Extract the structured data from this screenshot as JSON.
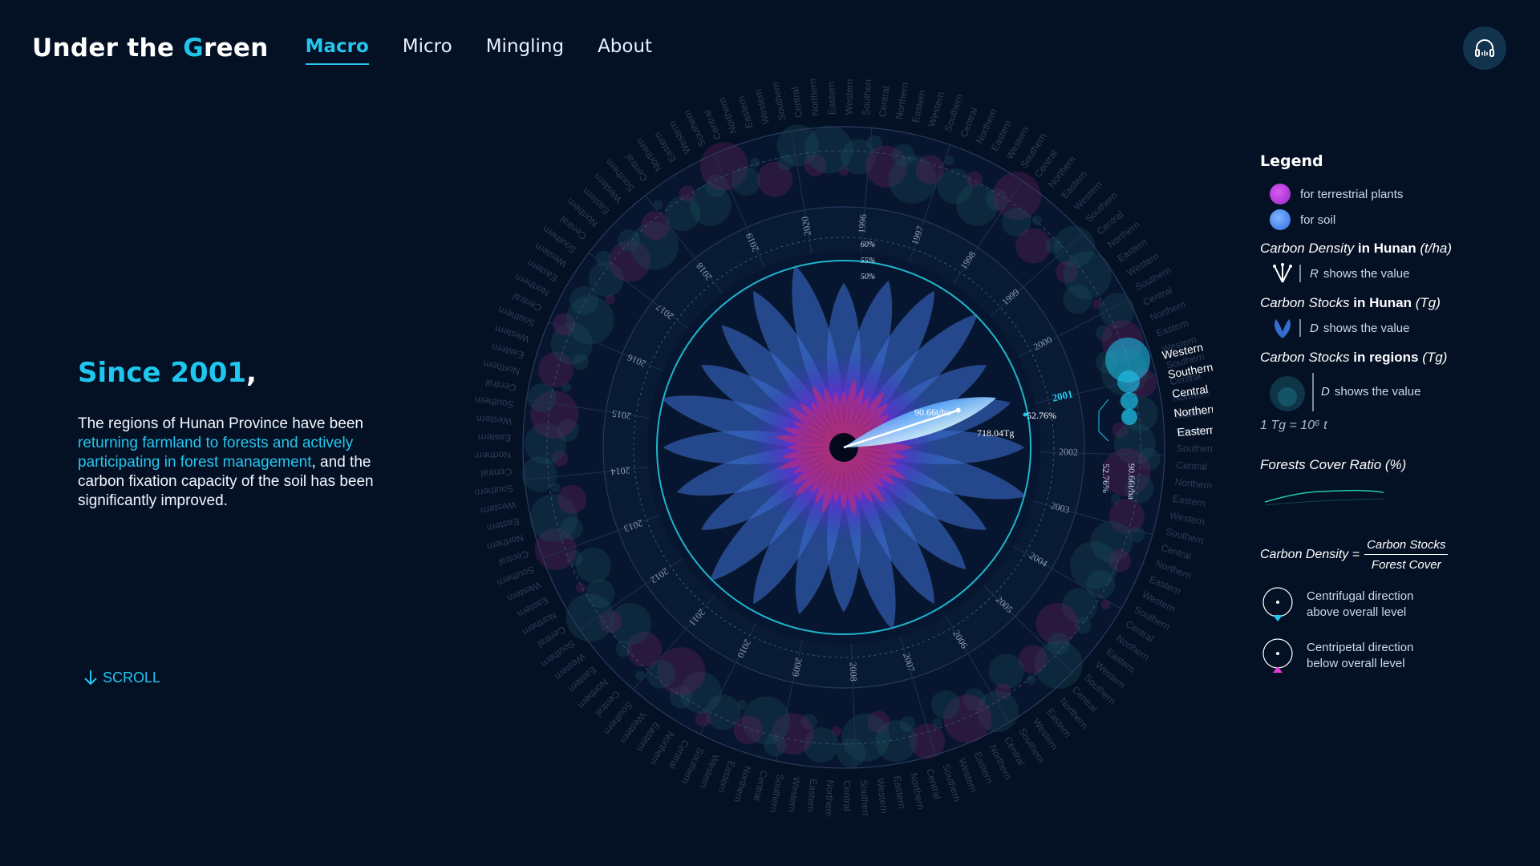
{
  "header": {
    "title_prefix": "Under the ",
    "title_g": "G",
    "title_rest": "reen",
    "nav": [
      "Macro",
      "Micro",
      "Mingling",
      "About"
    ],
    "active_nav": "Macro"
  },
  "intro": {
    "heading": "Since 2001",
    "heading_comma": ",",
    "body_1": "The regions of Hunan Province have been ",
    "body_highlight": "returning farmland to forests and actively participating in forest management",
    "body_2": ", and the carbon fixation capacity of the soil has been significantly improved."
  },
  "scroll_label": "SCROLL",
  "viz": {
    "years": [
      "1996",
      "1997",
      "1998",
      "1999",
      "2000",
      "2001",
      "2002",
      "2003",
      "2004",
      "2005",
      "2006",
      "2007",
      "2008",
      "2009",
      "2010",
      "2011",
      "2012",
      "2013",
      "2014",
      "2015",
      "2016",
      "2017",
      "2018",
      "2019",
      "2020"
    ],
    "highlight_year": "2001",
    "regions": [
      "Western",
      "Southern",
      "Central",
      "Northern",
      "Eastern"
    ],
    "density_label": "90.66t/ha",
    "stocks_label": "718.04Tg",
    "ratio_label": "52.76%",
    "ratio_label_outer": "52.76%",
    "density_label_outer": "90.66t/ha",
    "ratio_ticks": [
      "60%",
      "55%",
      "50%"
    ],
    "colors": {
      "accent": "#25c6ee",
      "plants": "#b03cdc",
      "soil": "#3f7ef0",
      "background": "#041024"
    }
  },
  "legend": {
    "title": "Legend",
    "plants": "for terrestrial plants",
    "soil": "for soil",
    "density_head_italic": "Carbon Density",
    "density_head_bold": "in Hunan",
    "density_head_unit": "(t/ha)",
    "density_desc_var": "R",
    "density_desc": "shows the value",
    "stocks_head_italic": "Carbon Stocks",
    "stocks_head_bold": "in Hunan",
    "stocks_head_unit": "(Tg)",
    "stocks_desc_var": "D",
    "stocks_desc": "shows the value",
    "regions_head_italic": "Carbon Stocks",
    "regions_head_bold": "in regions",
    "regions_head_unit": "(Tg)",
    "regions_desc_var": "D",
    "regions_desc": "shows the value",
    "unit_note": "1 Tg = 10⁶ t",
    "cover_ratio": "Forests Cover Ratio (%)",
    "formula_lhs": "Carbon Density =",
    "formula_num": "Carbon Stocks",
    "formula_den": "Forest Cover",
    "centrifugal_1": "Centrifugal direction",
    "centrifugal_2": "above overall level",
    "centripetal_1": "Centripetal direction",
    "centripetal_2": "below overall level"
  }
}
